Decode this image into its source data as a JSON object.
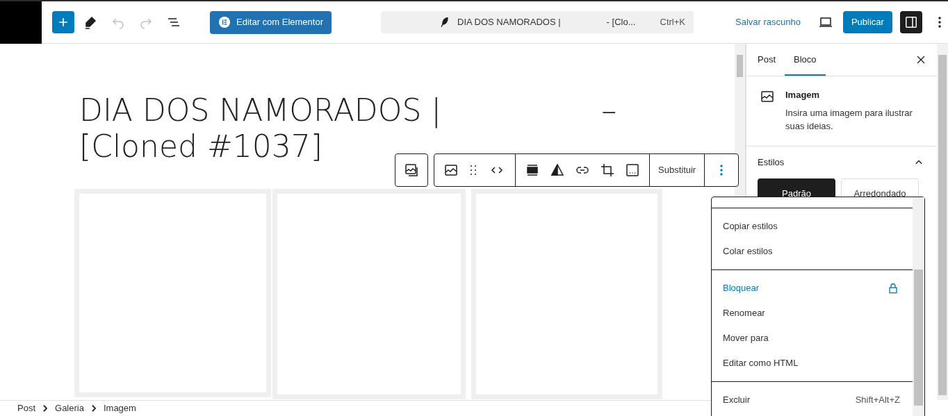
{
  "topbar": {
    "edit_elementor": "Editar com Elementor",
    "command": {
      "title": "DIA DOS NAMORADOS |",
      "suffix": "- [Clo...",
      "shortcut": "Ctrl+K"
    },
    "save_draft": "Salvar rascunho",
    "publish": "Publicar",
    "sidebar_toggle": {
      "selected": true
    }
  },
  "title": {
    "line1": "DIA DOS NAMORADOS |",
    "dash": "–",
    "line2": "[Cloned #1037]"
  },
  "block_toolbar": {
    "replace": "Substituir"
  },
  "gallery": {
    "images": [
      {
        "kind": "picture"
      },
      {
        "kind": "picture"
      },
      {
        "kind": "picture"
      }
    ]
  },
  "breadcrumb": [
    "Post",
    "Galeria",
    "Imagem"
  ],
  "sidebar": {
    "tabs": [
      {
        "label": "Post",
        "selected": false
      },
      {
        "label": "Bloco",
        "selected": true
      }
    ],
    "block": {
      "name": "Imagem",
      "description": "Insira uma imagem para ilustrar suas ideias."
    },
    "styles": {
      "title": "Estilos",
      "expanded": true,
      "options": [
        {
          "label": "Padrão",
          "selected": true
        },
        {
          "label": "Arredondado",
          "selected": false
        }
      ]
    }
  },
  "menu": {
    "groups": [
      [
        {
          "label": "Copiar estilos"
        },
        {
          "label": "Colar estilos"
        }
      ],
      [
        {
          "label": "Bloquear",
          "kind": "lock"
        },
        {
          "label": "Renomear"
        },
        {
          "label": "Mover para"
        },
        {
          "label": "Editar como HTML"
        }
      ],
      [
        {
          "label": "Excluir",
          "shortcut": "Shift+Alt+Z"
        }
      ]
    ]
  }
}
